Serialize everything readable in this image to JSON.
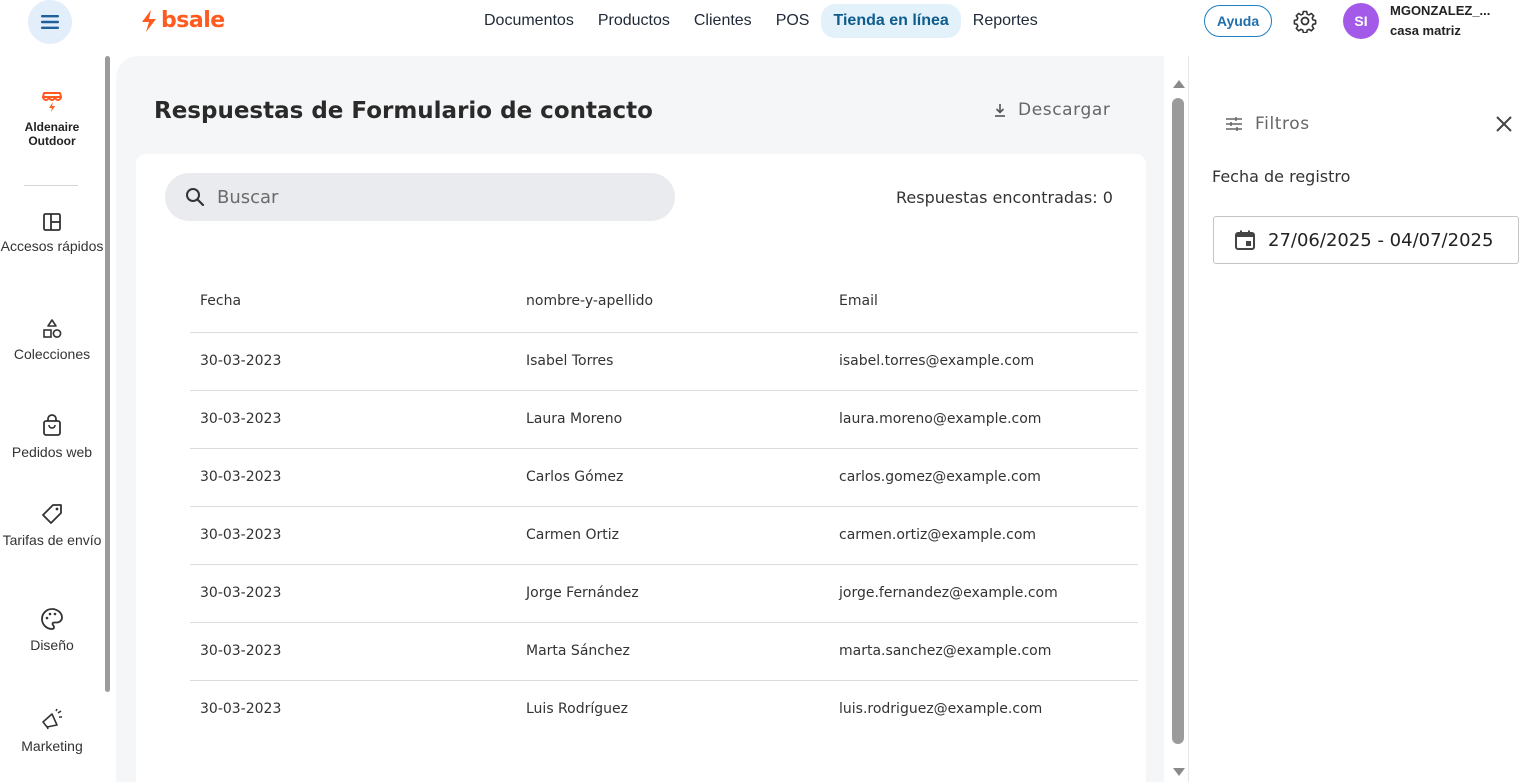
{
  "header": {
    "logo_text": "bsale",
    "nav": [
      {
        "label": "Documentos",
        "active": false
      },
      {
        "label": "Productos",
        "active": false
      },
      {
        "label": "Clientes",
        "active": false
      },
      {
        "label": "POS",
        "active": false
      },
      {
        "label": "Tienda en línea",
        "active": true
      },
      {
        "label": "Reportes",
        "active": false
      }
    ],
    "help_label": "Ayuda",
    "avatar_initials": "SI",
    "user_name": "MGONZALEZ_...",
    "user_branch": "casa matriz",
    "accent_color": "#a45ae8"
  },
  "sidebar": {
    "store_name": "Aldenaire Outdoor",
    "items": [
      {
        "label": "Accesos rápidos",
        "icon": "grid-icon"
      },
      {
        "label": "Colecciones",
        "icon": "shapes-icon"
      },
      {
        "label": "Pedidos web",
        "icon": "shopping-bag-icon"
      },
      {
        "label": "Tarifas de envío",
        "icon": "tag-icon"
      },
      {
        "label": "Diseño",
        "icon": "palette-icon"
      },
      {
        "label": "Marketing",
        "icon": "megaphone-icon"
      }
    ]
  },
  "main": {
    "title": "Respuestas de Formulario de contacto",
    "download_label": "Descargar",
    "search_placeholder": "Buscar",
    "results_count": "Respuestas encontradas: 0",
    "table": {
      "headers": [
        "Fecha",
        "nombre-y-apellido",
        "Email"
      ],
      "rows": [
        [
          "30-03-2023",
          "Isabel Torres",
          "isabel.torres@example.com"
        ],
        [
          "30-03-2023",
          "Laura Moreno",
          "laura.moreno@example.com"
        ],
        [
          "30-03-2023",
          "Carlos Gómez",
          "carlos.gomez@example.com"
        ],
        [
          "30-03-2023",
          "Carmen Ortiz",
          "carmen.ortiz@example.com"
        ],
        [
          "30-03-2023",
          "Jorge Fernández",
          "jorge.fernandez@example.com"
        ],
        [
          "30-03-2023",
          "Marta Sánchez",
          "marta.sanchez@example.com"
        ],
        [
          "30-03-2023",
          "Luis Rodríguez",
          "luis.rodriguez@example.com"
        ]
      ]
    }
  },
  "filters": {
    "title": "Filtros",
    "date_label": "Fecha de registro",
    "date_range": "27/06/2025 - 04/07/2025"
  }
}
